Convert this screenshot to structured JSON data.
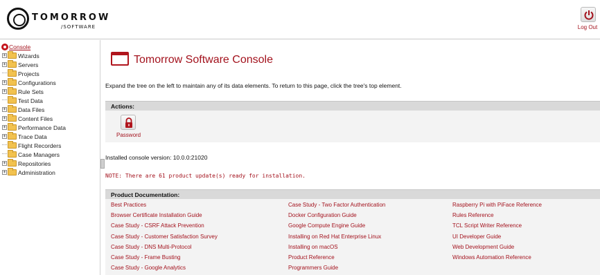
{
  "header": {
    "logo_word": "TOMORROW",
    "logo_sub": "/SOFTWARE",
    "logout_label": "Log Out"
  },
  "tree": {
    "root": "Console",
    "items": [
      {
        "label": "Wizards",
        "expandable": true
      },
      {
        "label": "Servers",
        "expandable": true
      },
      {
        "label": "Projects",
        "expandable": false
      },
      {
        "label": "Configurations",
        "expandable": true
      },
      {
        "label": "Rule Sets",
        "expandable": true
      },
      {
        "label": "Test Data",
        "expandable": false
      },
      {
        "label": "Data Files",
        "expandable": true
      },
      {
        "label": "Content Files",
        "expandable": true
      },
      {
        "label": "Performance Data",
        "expandable": true
      },
      {
        "label": "Trace Data",
        "expandable": true
      },
      {
        "label": "Flight Recorders",
        "expandable": false
      },
      {
        "label": "Case Managers",
        "expandable": false
      },
      {
        "label": "Repositories",
        "expandable": true
      },
      {
        "label": "Administration",
        "expandable": true
      }
    ]
  },
  "main": {
    "title": "Tomorrow Software Console",
    "intro": "Expand the tree on the left to maintain any of its data elements. To return to this page, click the tree's top element.",
    "actions_title": "Actions:",
    "password_label": "Password",
    "version": "Installed console version: 10.0.0:21020",
    "note": "NOTE: There are 61 product update(s) ready for installation.",
    "doc_title": "Product Documentation:",
    "doc_columns": [
      [
        "Best Practices",
        "Browser Certificate Installation Guide",
        "Case Study - CSRF Attack Prevention",
        "Case Study - Customer Satisfaction Survey",
        "Case Study - DNS Multi-Protocol",
        "Case Study - Frame Busting",
        "Case Study - Google Analytics"
      ],
      [
        "Case Study - Two Factor Authentication",
        "Docker Configuration Guide",
        "Google Compute Engine Guide",
        "Installing on Red Hat Enterprise Linux",
        "Installing on macOS",
        "Product Reference",
        "Programmers Guide"
      ],
      [
        "Raspberry Pi with PiFace Reference",
        "Rules Reference",
        "TCL Script Writer Reference",
        "UI Developer Guide",
        "Web Development Guide",
        "Windows Automation Reference"
      ]
    ]
  },
  "colors": {
    "accent": "#a3121d",
    "panel": "#f3f3f3",
    "bar": "#d9d9d9"
  },
  "icons": [
    "power-icon",
    "lock-icon",
    "console-gear-icon",
    "folder-icon",
    "expander-plus-icon",
    "window-icon"
  ]
}
